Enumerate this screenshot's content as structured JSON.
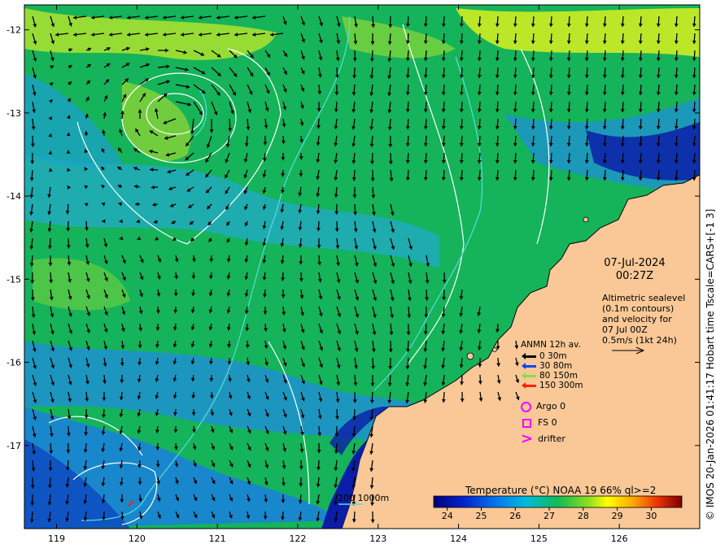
{
  "map": {
    "lon_ticks": [
      "119",
      "120",
      "121",
      "122",
      "123",
      "124",
      "125",
      "126"
    ],
    "lat_ticks": [
      "-12",
      "-13",
      "-14",
      "-15",
      "-16",
      "-17"
    ],
    "lon_range": [
      118.6,
      127.0
    ],
    "lat_range": [
      -18.0,
      -11.7
    ]
  },
  "info": {
    "date": "07-Jul-2024",
    "time": "00:27Z",
    "altimetry_lines": [
      "Altimetric sealevel",
      "(0.1m contours)",
      "and velocity for",
      "07 Jul 00Z",
      "0.5m/s (1kt 24h)"
    ]
  },
  "legend": {
    "title": "ANMN 12h av.",
    "items": [
      {
        "label": "0 30m",
        "color": "#000000"
      },
      {
        "label": "30 80m",
        "color": "#0044ff"
      },
      {
        "label": "80 150m",
        "color": "#88dd44"
      },
      {
        "label": "150 300m",
        "color": "#ff2200"
      }
    ],
    "argo": "Argo 0",
    "fs": "FS 0",
    "drifter": "drifter"
  },
  "colorbar": {
    "title": "Temperature (°C) NOAA 19 66% ql>=2",
    "ticks": [
      "24",
      "25",
      "26",
      "27",
      "28",
      "29",
      "30"
    ],
    "min": 23.6,
    "max": 30.9
  },
  "bathy_scale": "200  1000m",
  "credit": "© IMOS 20-Jan-2026 01:41:17 Hobart time Tscale=CARS+[-1 3]",
  "colors": {
    "land": "#f9c896",
    "arrow": "#000000",
    "contour": "#ffffff",
    "bathy": "#55dddd",
    "marker": "#ff00ff"
  }
}
